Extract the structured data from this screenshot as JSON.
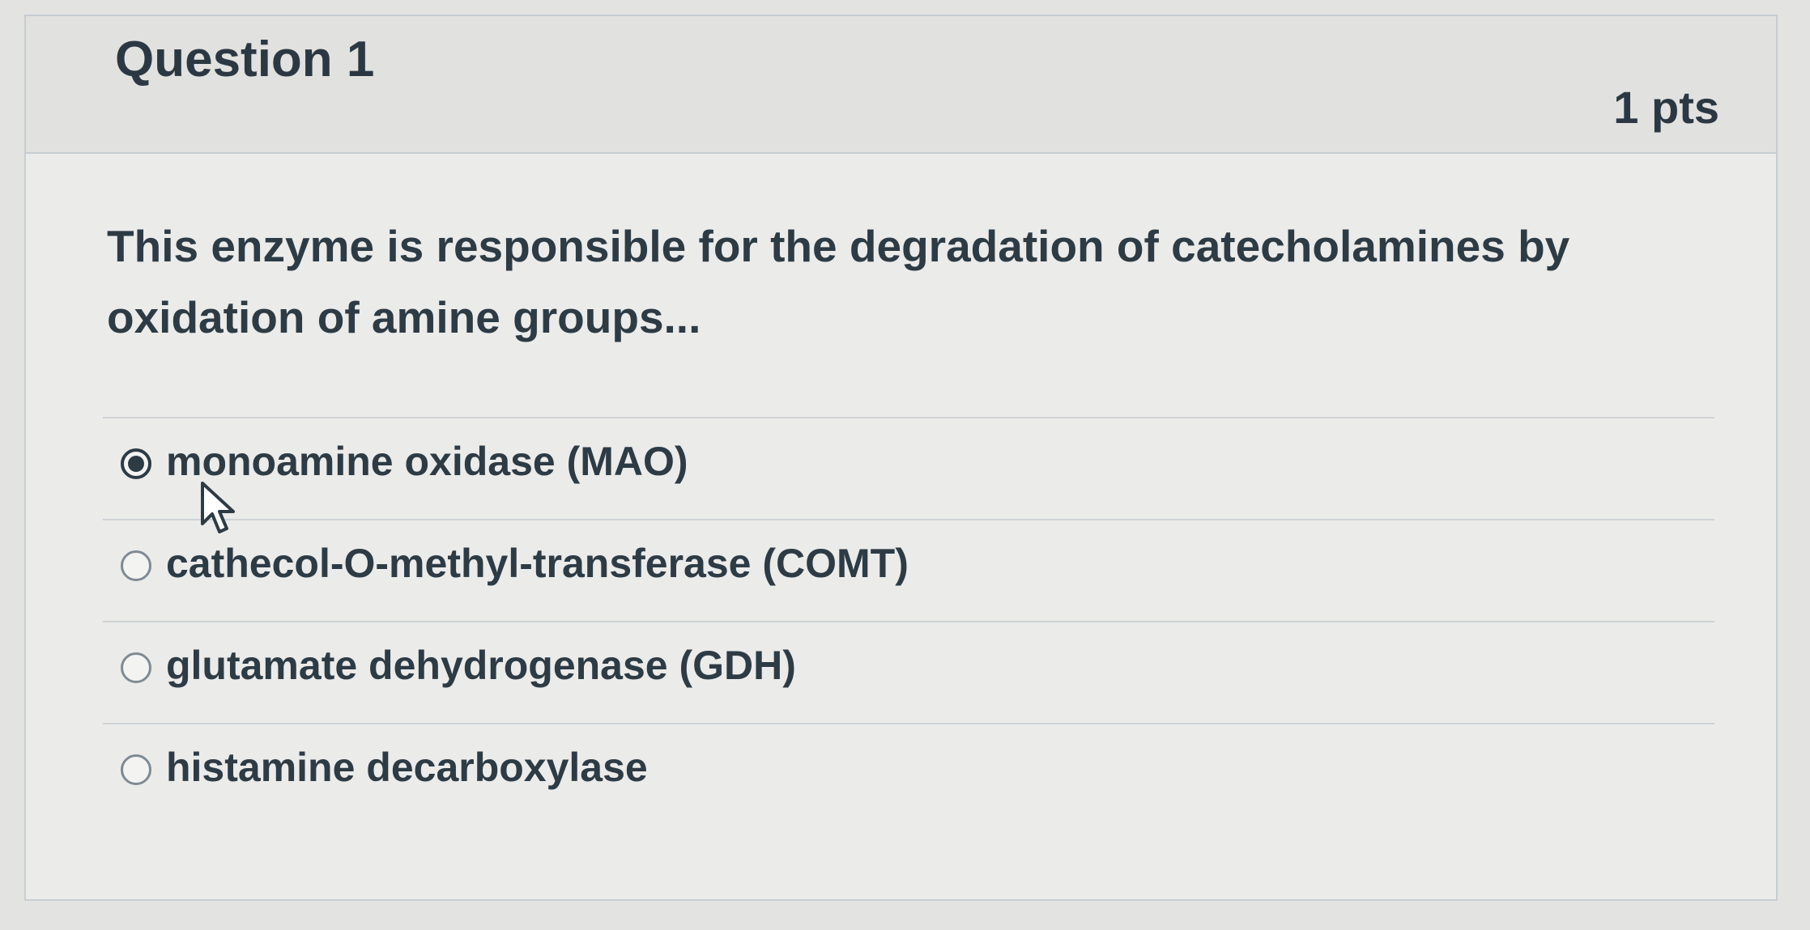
{
  "question": {
    "title": "Question 1",
    "points": "1 pts",
    "text": "This enzyme is responsible for the degradation of catecholamines by oxidation of amine groups..."
  },
  "answers": [
    {
      "label": "monoamine oxidase (MAO)",
      "selected": true
    },
    {
      "label": "cathecol-O-methyl-transferase (COMT)",
      "selected": false
    },
    {
      "label": "glutamate dehydrogenase (GDH)",
      "selected": false
    },
    {
      "label": "histamine decarboxylase",
      "selected": false
    }
  ],
  "icons": {
    "nav": "chevron-right-icon",
    "cursor": "mouse-pointer-icon"
  },
  "colors": {
    "background": "#e3e3e1",
    "header": "#e1e1df",
    "text": "#2d3b45",
    "border": "#c7cdd1"
  }
}
